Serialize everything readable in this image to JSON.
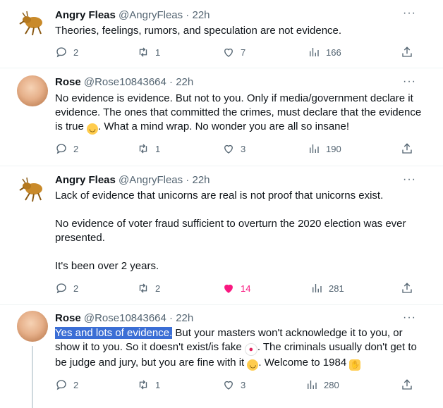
{
  "tweets": [
    {
      "name": "Angry Fleas",
      "handle": "@AngryFleas",
      "time": "22h",
      "paragraphs": [
        "Theories, feelings, rumors, and speculation are not evidence."
      ],
      "replies": "2",
      "retweets": "1",
      "likes": "7",
      "views": "166"
    },
    {
      "name": "Rose",
      "handle": "@Rose10843664",
      "time": "22h",
      "text_a": "No evidence is evidence. But not to you. Only if media/government declare it evidence. The ones that committed the crimes, must declare that the evidence is true ",
      "text_b": ". What a mind wrap. No wonder you are all so insane!",
      "replies": "2",
      "retweets": "1",
      "likes": "3",
      "views": "190"
    },
    {
      "name": "Angry Fleas",
      "handle": "@AngryFleas",
      "time": "22h",
      "paragraphs": [
        "Lack of evidence that unicorns are real is not proof that unicorns exist.",
        "No evidence of voter fraud sufficient to overturn the 2020 election was ever presented.",
        "It's been over 2 years."
      ],
      "replies": "2",
      "retweets": "2",
      "likes": "14",
      "views": "281"
    },
    {
      "name": "Rose",
      "handle": "@Rose10843664",
      "time": "22h",
      "highlight": "Yes and lots of evidence.",
      "text_a": " But your masters won't acknowledge it to you, or show it to you. So it doesn't exist/is fake ",
      "text_b": ". The criminals usually don't get to be judge and jury, but you are fine with it ",
      "text_c": ". Welcome to 1984 ",
      "replies": "2",
      "retweets": "1",
      "likes": "3",
      "views": "280"
    }
  ],
  "ui": {
    "separator": " · ",
    "more": "···"
  },
  "icons": [
    "reply-icon",
    "retweet-icon",
    "like-icon",
    "views-icon",
    "share-icon",
    "more-icon"
  ],
  "colors": {
    "liked": "#f91880",
    "muted": "#536471",
    "highlight": "#3b6ed5"
  }
}
